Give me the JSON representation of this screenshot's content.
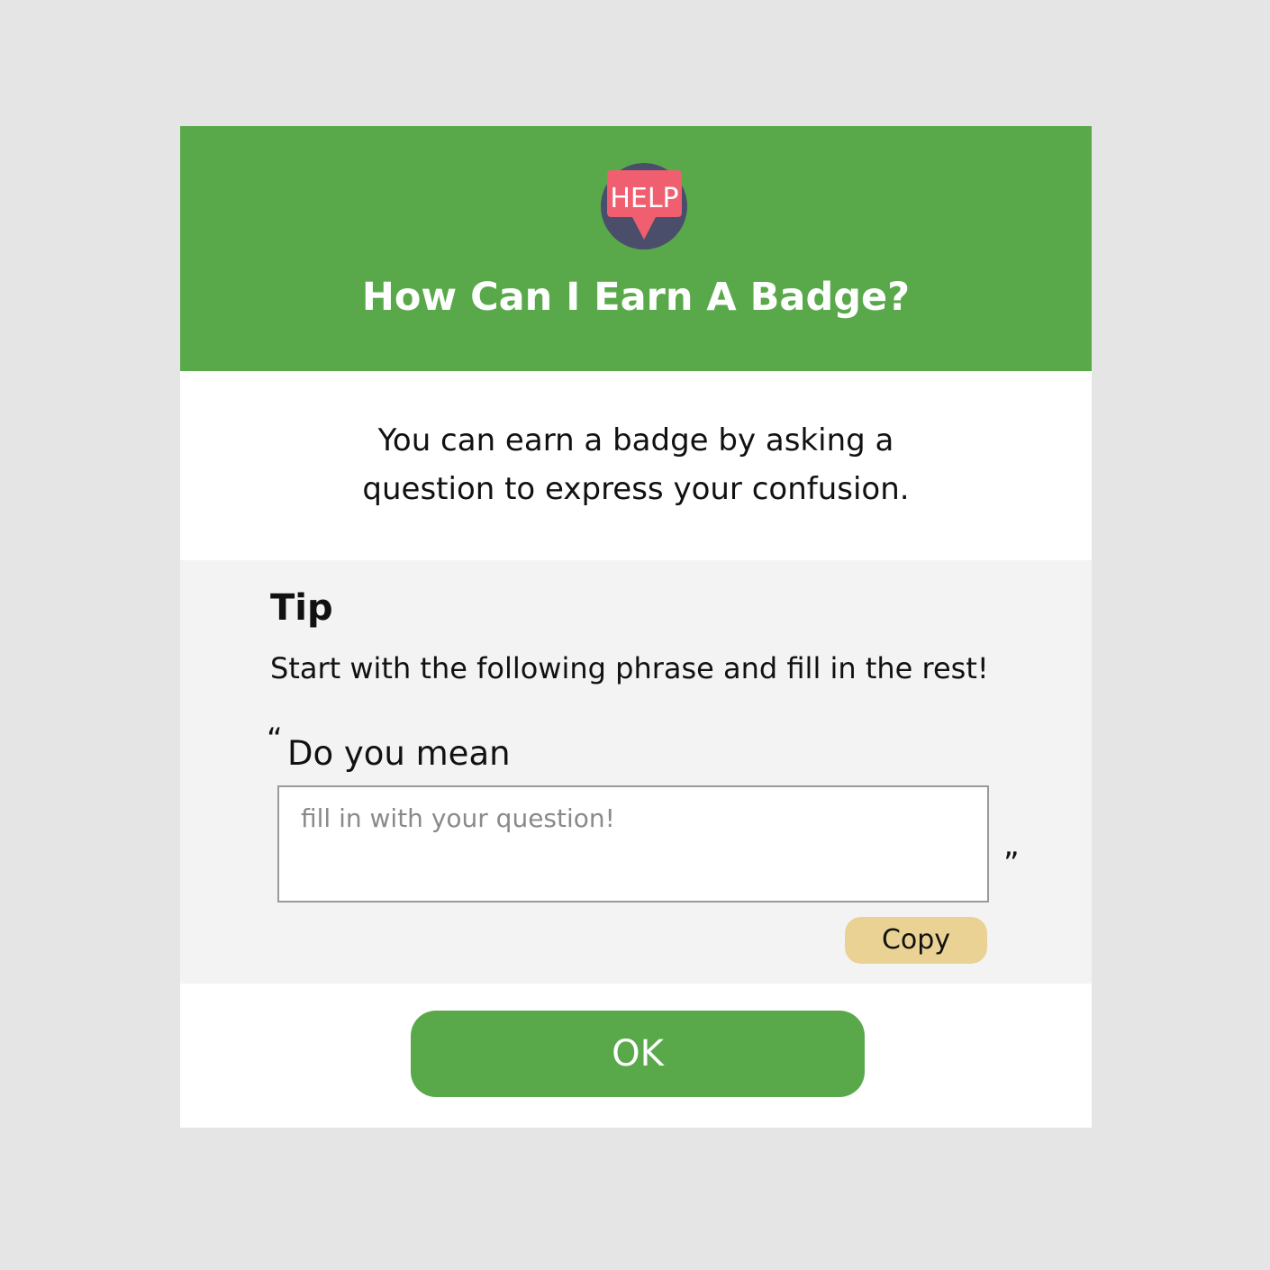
{
  "dialog": {
    "icon": {
      "name": "help-speech-bubble-icon",
      "label": "HELP"
    },
    "title": "How Can I Earn A Badge?",
    "description_lines": [
      "You can earn a badge by asking a",
      "question to express your confusion."
    ],
    "tip": {
      "title": "Tip",
      "text": "Start with the following phrase and fill in the rest!",
      "open_quote": "“",
      "phrase": "Do you mean",
      "input_placeholder": "fill in with your question!",
      "input_value": "",
      "close_quote": "”",
      "copy_label": "Copy"
    },
    "ok_label": "OK"
  },
  "colors": {
    "background": "#e5e5e5",
    "header_green": "#59a94b",
    "tip_panel": "#f4f3f4",
    "copy_button": "#e9d293",
    "help_bubble": "#ef5f6f",
    "icon_circle": "#4a4e6b"
  }
}
